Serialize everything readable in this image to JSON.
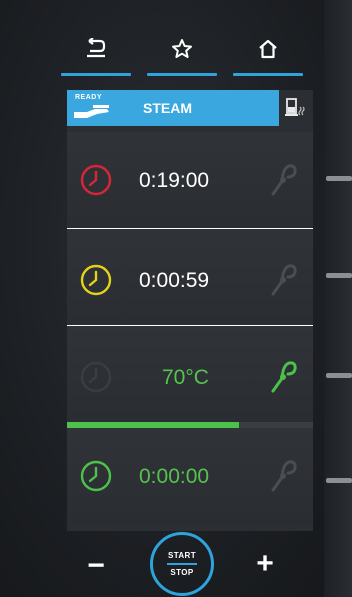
{
  "nav": [
    {
      "icon": "back-icon"
    },
    {
      "icon": "star-icon"
    },
    {
      "icon": "home-icon"
    }
  ],
  "header": {
    "status": "READY",
    "mode": "STEAM",
    "right_icon": "water-steam-icon"
  },
  "steps": [
    {
      "value": "0:19:00",
      "clock_color": "#d8253a",
      "text_color": "#ffffff",
      "probe_active": false
    },
    {
      "value": "0:00:59",
      "clock_color": "#e2d21a",
      "text_color": "#ffffff",
      "probe_active": false
    },
    {
      "value": "70°C",
      "clock_color": "#3a3d41",
      "text_color": "#56c34e",
      "probe_active": true
    },
    {
      "value": "0:00:00",
      "clock_color": "#4cc24a",
      "text_color": "#56c34e",
      "probe_active": false
    }
  ],
  "progress": {
    "fraction": 0.7
  },
  "colors": {
    "accent": "#2ea3dc",
    "green": "#4cc24a",
    "probe_inactive": "#4a4d52"
  },
  "controls": {
    "minus": "−",
    "plus": "+",
    "start": "START",
    "stop": "STOP"
  }
}
